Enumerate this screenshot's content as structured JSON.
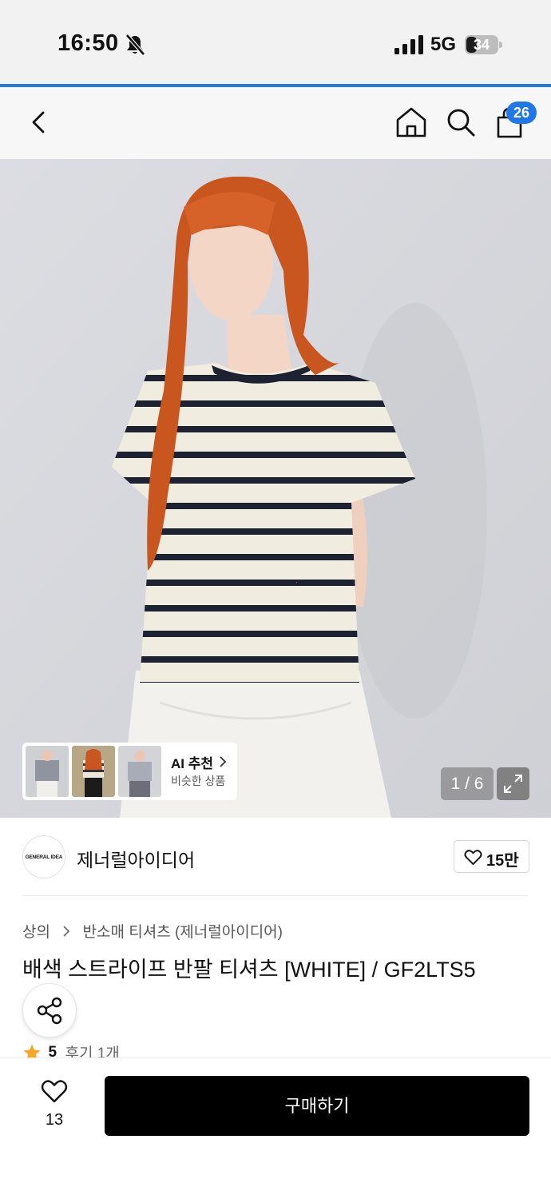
{
  "status_bar": {
    "time": "16:50",
    "network": "5G",
    "battery_level": "34",
    "battery_fraction": 0.34
  },
  "colors": {
    "accent_blue": "#1f78e5",
    "badge_blue": "#1f78e5",
    "buy_button": "#000000",
    "star": "#f5a623"
  },
  "nav": {
    "cart_count": "26",
    "icons": [
      "chevron-left-icon",
      "home-icon",
      "search-icon",
      "shopping-bag-icon"
    ]
  },
  "gallery": {
    "page_indicator": "1 / 6",
    "ai_recommend": {
      "title": "AI 추천",
      "subtitle": "비슷한 상품"
    }
  },
  "brand": {
    "logo_text": "GENERAL IDEA",
    "name": "제너럴아이디어",
    "likes": "15만"
  },
  "product": {
    "breadcrumb": [
      "상의",
      "반소매 티셔츠 (제너럴아이디어)"
    ],
    "title": "배색 스트라이프 반팔 티셔츠 [WHITE] / GF2LTS5",
    "rating": "5",
    "reviews": "후기 1개"
  },
  "bottom": {
    "wishlist_count": "13",
    "buy_label": "구매하기"
  }
}
